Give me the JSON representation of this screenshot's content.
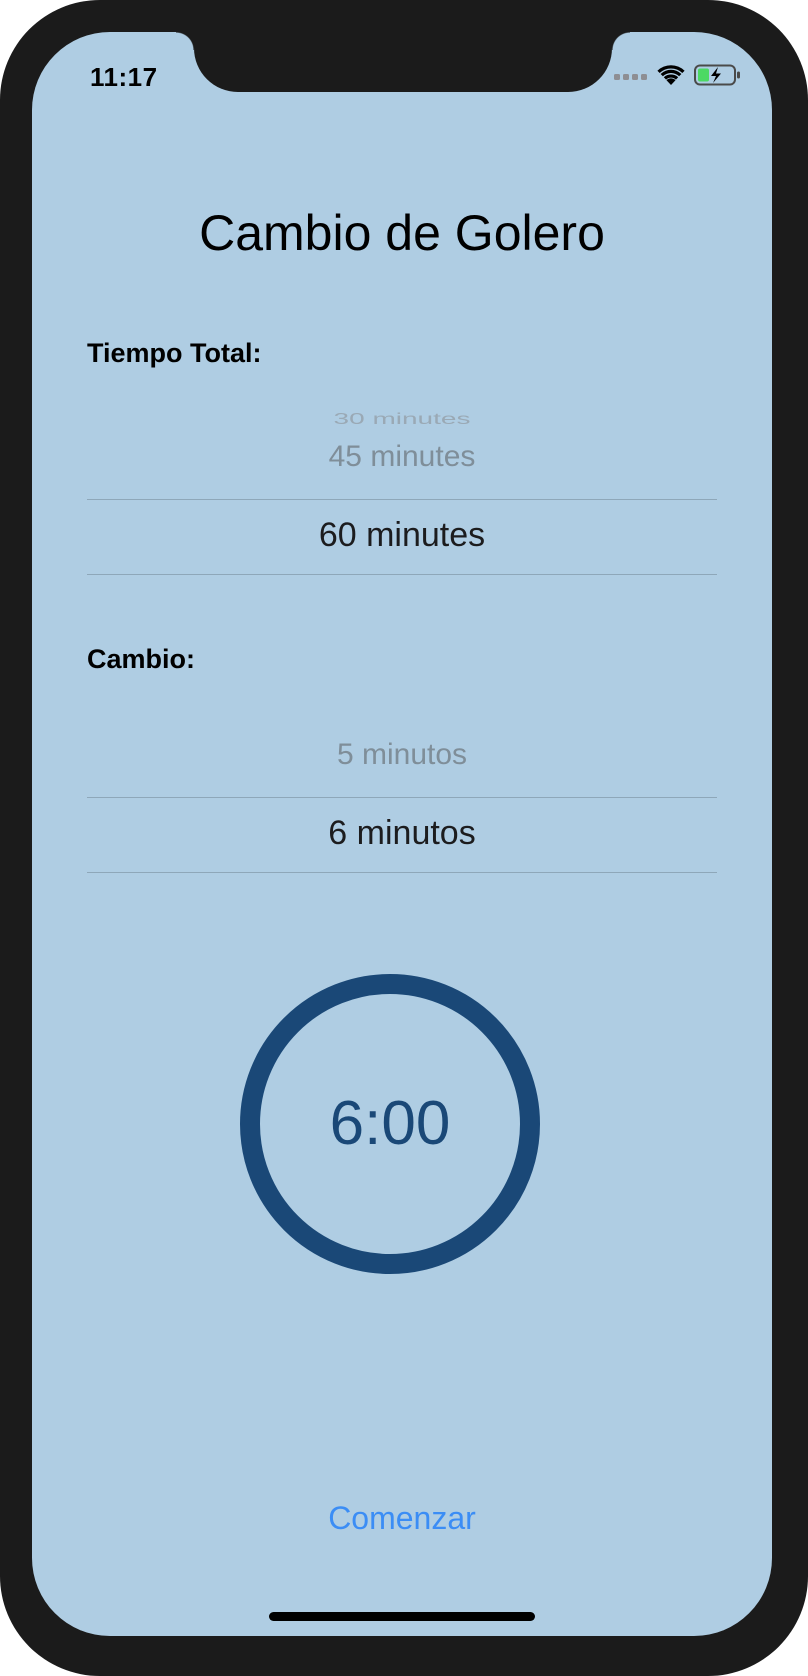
{
  "status_bar": {
    "time": "11:17",
    "signal_icon": "cellular-dots-icon",
    "wifi_icon": "wifi-icon",
    "battery_icon": "battery-charging-icon"
  },
  "title": "Cambio de Golero",
  "total_time": {
    "label": "Tiempo Total:",
    "options_above": [
      "30 minutes",
      "45 minutes"
    ],
    "selected": "60 minutes"
  },
  "change": {
    "label": "Cambio:",
    "options_above": [
      "5 minutos"
    ],
    "selected": "6 minutos"
  },
  "timer": {
    "display": "6:00",
    "ring_color": "#1a4877"
  },
  "start_button": {
    "label": "Comenzar",
    "color": "#3b8df5"
  },
  "colors": {
    "background": "#afcde3",
    "device_frame": "#1b1b1b"
  }
}
